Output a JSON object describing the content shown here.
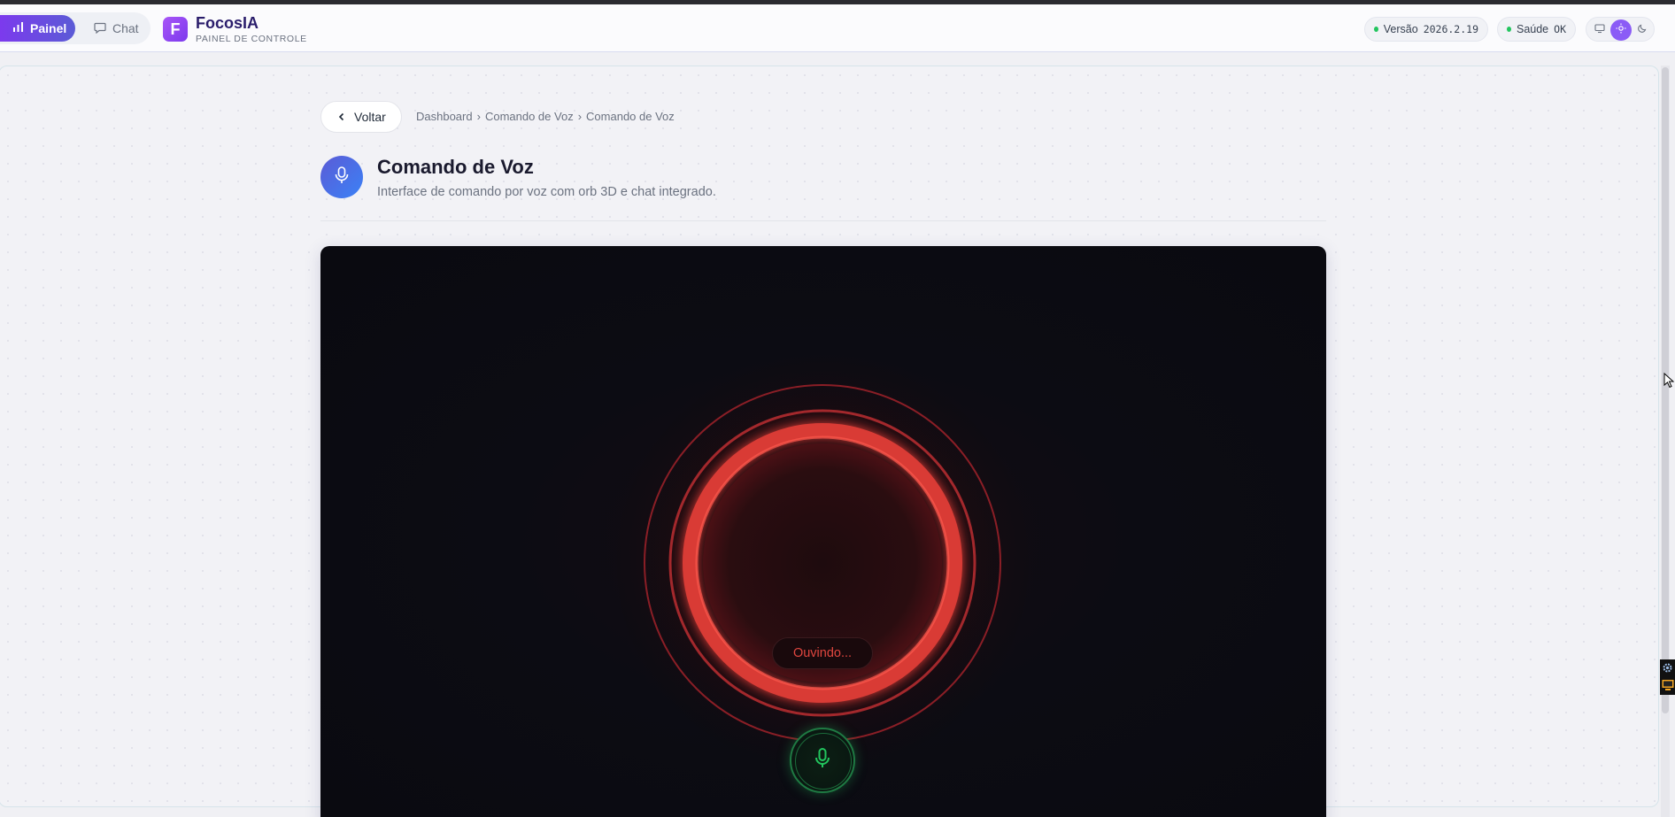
{
  "header": {
    "nav": [
      {
        "label": "Painel",
        "icon": "bar-chart-icon",
        "active": true
      },
      {
        "label": "Chat",
        "icon": "chat-bubble-icon",
        "active": false
      }
    ],
    "brand": {
      "logo_letter": "F",
      "name": "FocosIA",
      "subtitle": "PAINEL DE CONTROLE"
    },
    "version": {
      "label": "Versão",
      "value": "2026.2.19"
    },
    "health": {
      "label": "Saúde",
      "value": "OK"
    },
    "theme_options": [
      "monitor-icon",
      "sun-icon",
      "moon-icon"
    ],
    "active_theme": "sun-icon"
  },
  "page": {
    "back_label": "Voltar",
    "breadcrumb": [
      "Dashboard",
      "Comando de Voz",
      "Comando de Voz"
    ],
    "breadcrumb_separator": "›",
    "title": "Comando de Voz",
    "description": "Interface de comando por voz com orb 3D e chat integrado."
  },
  "voice": {
    "status": "Ouvindo...",
    "state": "listening",
    "orb_color": "#e53935",
    "mic_color": "#22c55e"
  },
  "colors": {
    "accent": "#7c3aed",
    "health_dot": "#22c55e",
    "status_text": "#e0463f"
  }
}
